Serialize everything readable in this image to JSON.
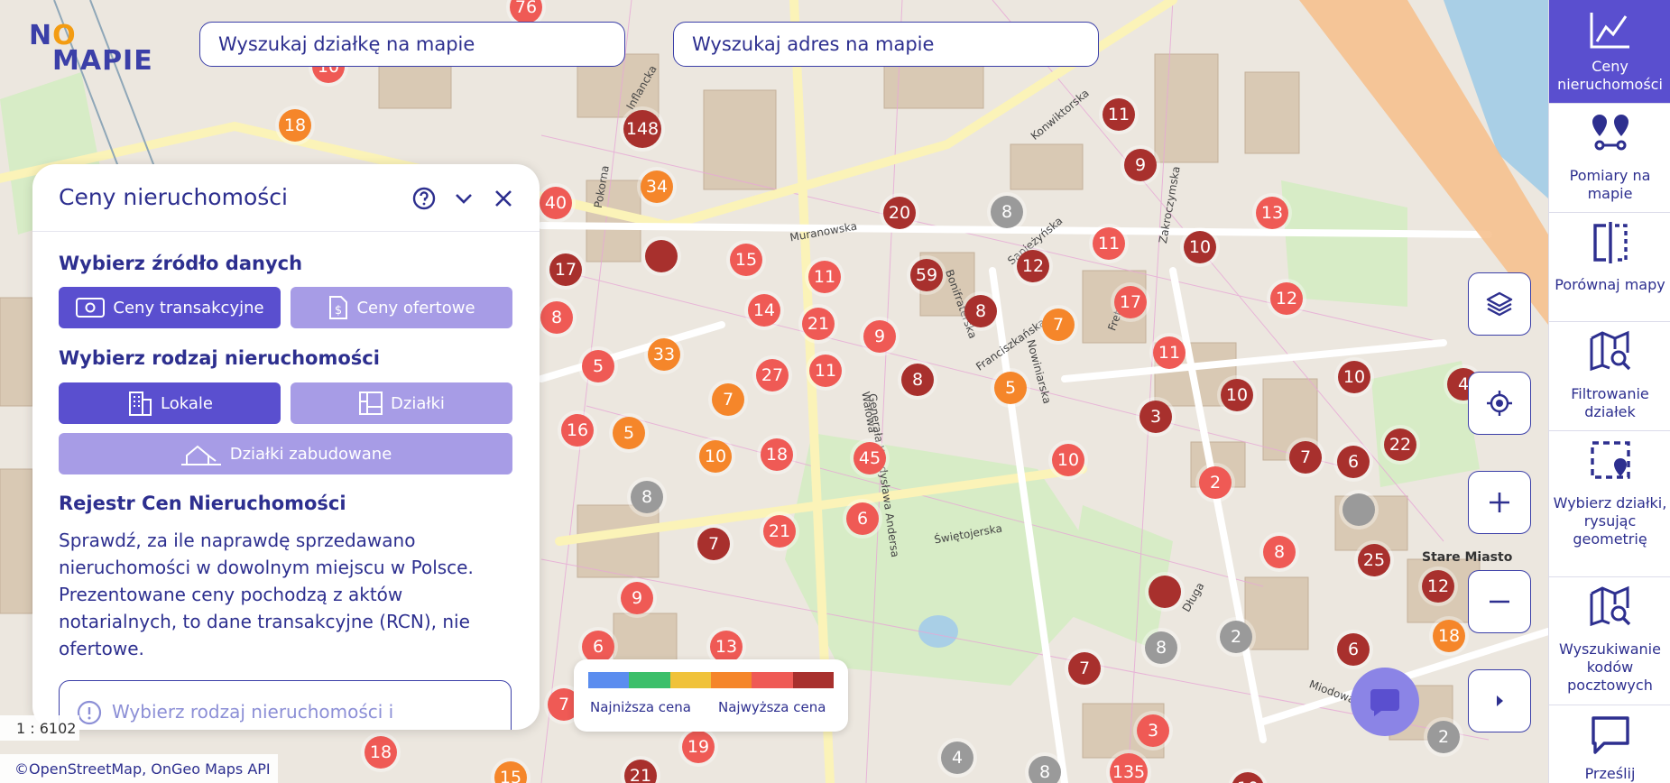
{
  "logo": {
    "text_a": "N",
    "text_b": "O",
    "text_c": "MAPIE"
  },
  "search": {
    "parcel_placeholder": "Wyszukaj działkę na mapie",
    "address_placeholder": "Wyszukaj adres na mapie"
  },
  "panel": {
    "title": "Ceny nieruchomości",
    "source_heading": "Wybierz źródło danych",
    "source_options": {
      "transactional": "Ceny transakcyjne",
      "offer": "Ceny ofertowe"
    },
    "type_heading": "Wybierz rodzaj nieruchomości",
    "type_options": {
      "premises": "Lokale",
      "plots": "Działki",
      "built_plots": "Działki zabudowane"
    },
    "registry_heading": "Rejestr Cen Nieruchomości",
    "registry_text": "Sprawdź, za ile naprawdę sprzedawano nieruchomości w dowolnym miejscu w Polsce. Prezentowane ceny pochodzą z aktów notarialnych, to dane transakcyjne (RCN), nie ofertowe.",
    "info_text": "Wybierz rodzaj nieruchomości i"
  },
  "scale": "1 : 6102",
  "attribution": "©OpenStreetMap, OnGeo Maps API",
  "legend": {
    "low": "Najniższa cena",
    "high": "Najwyższa cena",
    "colors": [
      "#5b8def",
      "#3cbf6a",
      "#f0c23a",
      "#f5862a",
      "#ef5a55",
      "#a8302d"
    ]
  },
  "map_controls": [
    "layers-icon",
    "locate-icon",
    "zoom-in-icon",
    "zoom-out-icon",
    "expand-icon"
  ],
  "sidebar": {
    "items": [
      {
        "label": "Ceny nieruchomości",
        "icon": "chart-icon"
      },
      {
        "label": "Pomiary na mapie",
        "icon": "measure-icon"
      },
      {
        "label": "Porównaj mapy",
        "icon": "compare-icon"
      },
      {
        "label": "Filtrowanie działek",
        "icon": "map-search-icon"
      },
      {
        "label": "Wybierz działki, rysując geometrię",
        "icon": "select-area-icon"
      },
      {
        "label": "Wyszukiwanie kodów pocztowych",
        "icon": "map-search-icon"
      },
      {
        "label": "Prześlij",
        "icon": "message-icon"
      }
    ]
  },
  "map_labels": [
    "Muranowska",
    "Świętojerska",
    "Generała Władysława Andersa",
    "Stare Miasto",
    "Franciszkańska",
    "Bonifraterska",
    "Sapieżyńska",
    "Długa",
    "Miodowa",
    "Konwiktorska",
    "Zakroczymska",
    "Freta",
    "Inflancka",
    "Pokorna",
    "Wałowa",
    "Nowiniarska"
  ],
  "markers": [
    {
      "v": "76",
      "c": "#ef5a55"
    },
    {
      "v": "10",
      "c": "#ef5a55"
    },
    {
      "v": "18",
      "c": "#f5862a"
    },
    {
      "v": "148",
      "c": "#a8302d"
    },
    {
      "v": "34",
      "c": "#f5862a"
    },
    {
      "v": "40",
      "c": "#ef5a55"
    },
    {
      "v": "17",
      "c": "#a8302d"
    },
    {
      "v": "",
      "c": "#a8302d"
    },
    {
      "v": "15",
      "c": "#ef5a55"
    },
    {
      "v": "11",
      "c": "#ef5a55"
    },
    {
      "v": "8",
      "c": "#ef5a55"
    },
    {
      "v": "14",
      "c": "#ef5a55"
    },
    {
      "v": "21",
      "c": "#ef5a55"
    },
    {
      "v": "9",
      "c": "#ef5a55"
    },
    {
      "v": "33",
      "c": "#f5862a"
    },
    {
      "v": "5",
      "c": "#ef5a55"
    },
    {
      "v": "27",
      "c": "#ef5a55"
    },
    {
      "v": "11",
      "c": "#ef5a55"
    },
    {
      "v": "7",
      "c": "#f5862a"
    },
    {
      "v": "16",
      "c": "#ef5a55"
    },
    {
      "v": "5",
      "c": "#f5862a"
    },
    {
      "v": "10",
      "c": "#f5862a"
    },
    {
      "v": "18",
      "c": "#ef5a55"
    },
    {
      "v": "45",
      "c": "#ef5a55"
    },
    {
      "v": "8",
      "c": "#9a9a9a"
    },
    {
      "v": "7",
      "c": "#a8302d"
    },
    {
      "v": "21",
      "c": "#ef5a55"
    },
    {
      "v": "6",
      "c": "#ef5a55"
    },
    {
      "v": "9",
      "c": "#ef5a55"
    },
    {
      "v": "6",
      "c": "#ef5a55"
    },
    {
      "v": "13",
      "c": "#ef5a55"
    },
    {
      "v": "7",
      "c": "#ef5a55"
    },
    {
      "v": "18",
      "c": "#ef5a55"
    },
    {
      "v": "19",
      "c": "#ef5a55"
    },
    {
      "v": "15",
      "c": "#f5862a"
    },
    {
      "v": "21",
      "c": "#a8302d"
    },
    {
      "v": "20",
      "c": "#a8302d"
    },
    {
      "v": "8",
      "c": "#9a9a9a"
    },
    {
      "v": "59",
      "c": "#a8302d"
    },
    {
      "v": "12",
      "c": "#a8302d"
    },
    {
      "v": "8",
      "c": "#a8302d"
    },
    {
      "v": "7",
      "c": "#f5862a"
    },
    {
      "v": "8",
      "c": "#a8302d"
    },
    {
      "v": "5",
      "c": "#f5862a"
    },
    {
      "v": "11",
      "c": "#ef5a55"
    },
    {
      "v": "17",
      "c": "#ef5a55"
    },
    {
      "v": "11",
      "c": "#ef5a55"
    },
    {
      "v": "3",
      "c": "#a8302d"
    },
    {
      "v": "10",
      "c": "#ef5a55"
    },
    {
      "v": "10",
      "c": "#a8302d"
    },
    {
      "v": "11",
      "c": "#a8302d"
    },
    {
      "v": "9",
      "c": "#a8302d"
    },
    {
      "v": "13",
      "c": "#ef5a55"
    },
    {
      "v": "10",
      "c": "#a8302d"
    },
    {
      "v": "12",
      "c": "#ef5a55"
    },
    {
      "v": "10",
      "c": "#a8302d"
    },
    {
      "v": "4",
      "c": "#a8302d"
    },
    {
      "v": "22",
      "c": "#a8302d"
    },
    {
      "v": "7",
      "c": "#a8302d"
    },
    {
      "v": "6",
      "c": "#a8302d"
    },
    {
      "v": "2",
      "c": "#ef5a55"
    },
    {
      "v": "",
      "c": "#9a9a9a"
    },
    {
      "v": "25",
      "c": "#a8302d"
    },
    {
      "v": "8",
      "c": "#ef5a55"
    },
    {
      "v": "12",
      "c": "#a8302d"
    },
    {
      "v": "",
      "c": "#a8302d"
    },
    {
      "v": "18",
      "c": "#f5862a"
    },
    {
      "v": "8",
      "c": "#9a9a9a"
    },
    {
      "v": "2",
      "c": "#9a9a9a"
    },
    {
      "v": "6",
      "c": "#a8302d"
    },
    {
      "v": "7",
      "c": "#a8302d"
    },
    {
      "v": "3",
      "c": "#ef5a55"
    },
    {
      "v": "2",
      "c": "#9a9a9a"
    },
    {
      "v": "4",
      "c": "#9a9a9a"
    },
    {
      "v": "135",
      "c": "#ef5a55"
    },
    {
      "v": "8",
      "c": "#9a9a9a"
    },
    {
      "v": "10",
      "c": "#a8302d"
    }
  ]
}
